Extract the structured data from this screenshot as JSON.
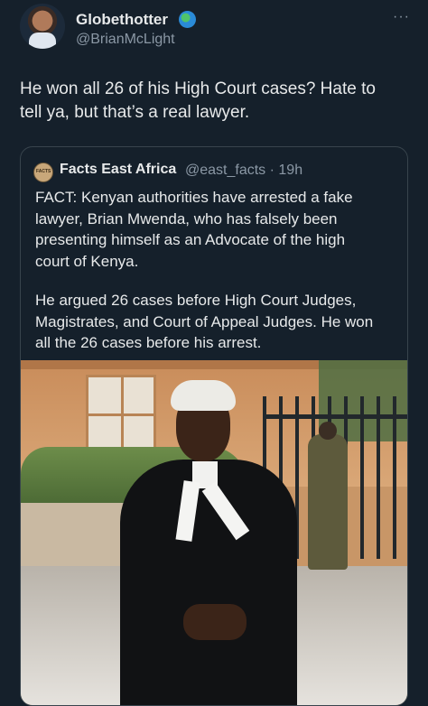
{
  "tweet": {
    "display_name": "Globethotter",
    "handle": "@BrianMcLight",
    "text": "He won all 26 of his High Court cases? Hate to\ntell ya, but that’s a real lawyer.",
    "more_symbol": "···"
  },
  "quote": {
    "display_name": "Facts East Africa",
    "handle_time": "@east_facts · 19h",
    "paragraph1": "FACT: Kenyan authorities have arrested a fake\nlawyer, Brian Mwenda, who has falsely been\npresenting himself as an Advocate of the high\ncourt of Kenya.",
    "paragraph2": "He argued 26 cases before High Court Judges,\nMagistrates, and Court of Appeal Judges. He won\nall the 26 cases before his arrest."
  },
  "colors": {
    "background": "#15202b",
    "text": "#e7e9ea",
    "muted": "#8b98a5",
    "border": "#38444d"
  },
  "icons": {
    "verified": "globe-icon",
    "more": "more-icon"
  }
}
